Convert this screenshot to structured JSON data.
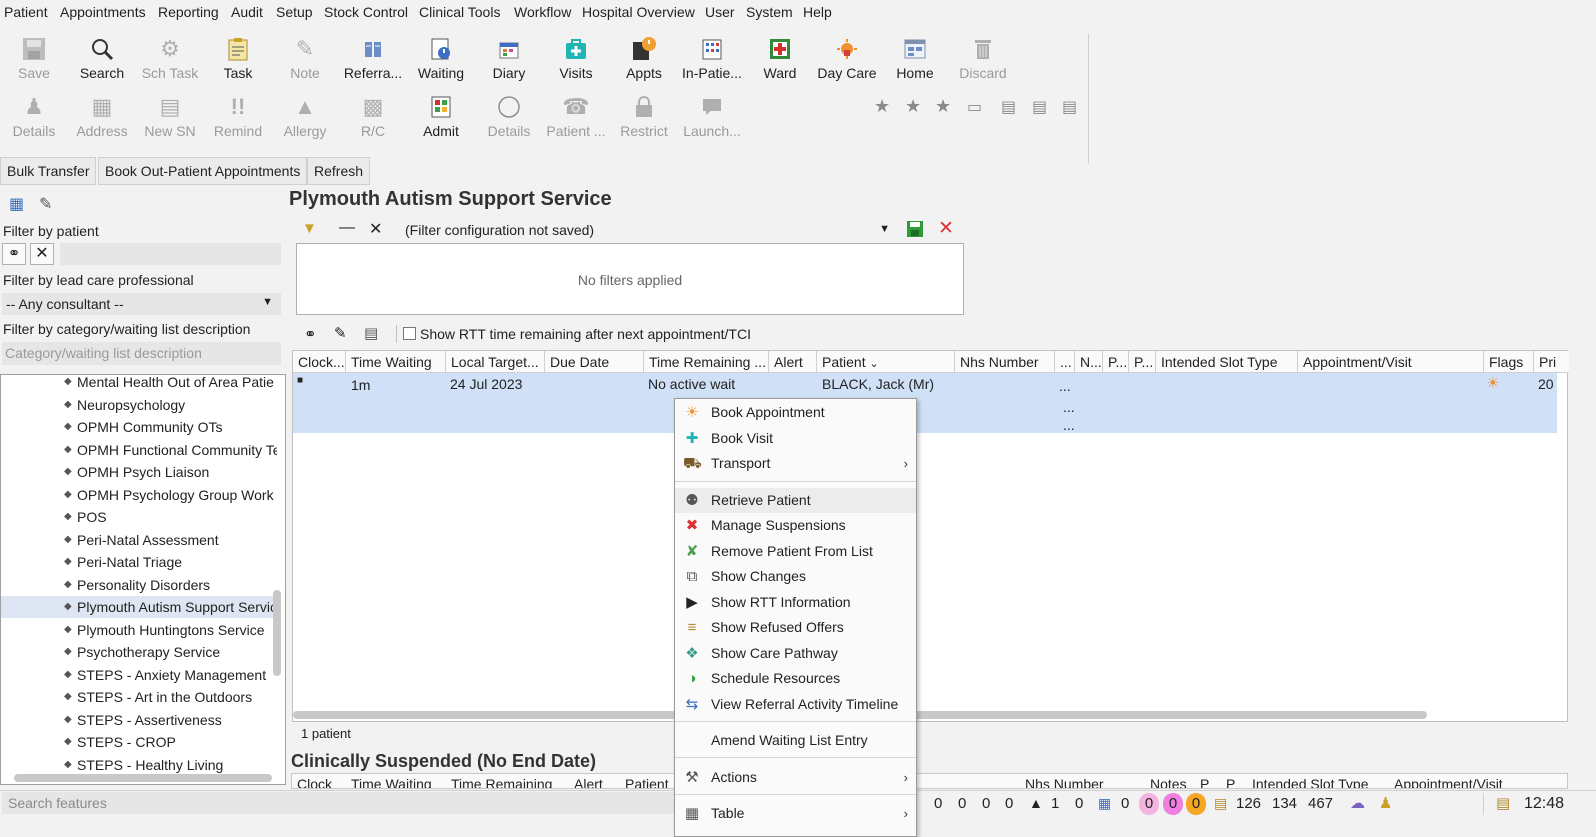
{
  "menubar": [
    {
      "label": "Patient"
    },
    {
      "label": "Appointments"
    },
    {
      "label": "Reporting"
    },
    {
      "label": "Audit"
    },
    {
      "label": "Setup"
    },
    {
      "label": "Stock Control"
    },
    {
      "label": "Clinical Tools"
    },
    {
      "label": "Workflow"
    },
    {
      "label": "Hospital Overview"
    },
    {
      "label": "User"
    },
    {
      "label": "System"
    },
    {
      "label": "Help"
    }
  ],
  "toolbar_row1": [
    {
      "label": "Save",
      "icon": "save-icon",
      "enabled": false
    },
    {
      "label": "Search",
      "icon": "search-icon",
      "enabled": true
    },
    {
      "label": "Sch Task",
      "icon": "scheduled-task-icon",
      "enabled": false
    },
    {
      "label": "Task",
      "icon": "task-icon",
      "enabled": true
    },
    {
      "label": "Note",
      "icon": "note-icon",
      "enabled": false
    },
    {
      "label": "Referra...",
      "icon": "referral-icon",
      "enabled": true
    },
    {
      "label": "Waiting",
      "icon": "waiting-list-icon",
      "enabled": true
    },
    {
      "label": "Diary",
      "icon": "diary-icon",
      "enabled": true
    },
    {
      "label": "Visits",
      "icon": "visits-icon",
      "enabled": true
    },
    {
      "label": "Appts",
      "icon": "appointments-icon",
      "enabled": true
    },
    {
      "label": "In-Patie...",
      "icon": "in-patient-icon",
      "enabled": true
    },
    {
      "label": "Ward",
      "icon": "ward-icon",
      "enabled": true
    },
    {
      "label": "Day Care",
      "icon": "day-care-icon",
      "enabled": true
    },
    {
      "label": "Home",
      "icon": "home-icon",
      "enabled": true
    },
    {
      "label": "Discard",
      "icon": "discard-icon",
      "enabled": false
    }
  ],
  "toolbar_row2": [
    {
      "label": "Details",
      "icon": "patient-details-icon",
      "enabled": false
    },
    {
      "label": "Address",
      "icon": "address-icon",
      "enabled": false
    },
    {
      "label": "New SN",
      "icon": "new-sn-icon",
      "enabled": false
    },
    {
      "label": "Remind",
      "icon": "remind-icon",
      "enabled": false
    },
    {
      "label": "Allergy",
      "icon": "allergy-icon",
      "enabled": false
    },
    {
      "label": "R/C",
      "icon": "rc-icon",
      "enabled": false
    },
    {
      "label": "Admit",
      "icon": "admit-icon",
      "enabled": true
    },
    {
      "label": "Details",
      "icon": "details-circle-icon",
      "enabled": false
    },
    {
      "label": "Patient ...",
      "icon": "patient-phone-icon",
      "enabled": false
    },
    {
      "label": "Restrict",
      "icon": "restrict-icon",
      "enabled": false
    },
    {
      "label": "Launch...",
      "icon": "launch-icon",
      "enabled": false
    }
  ],
  "action_buttons": [
    "Bulk Transfer",
    "Book Out-Patient Appointments",
    "Refresh"
  ],
  "left_panel": {
    "filter_patient_label": "Filter by patient",
    "filter_lead_label": "Filter by lead care professional",
    "consultant_value": "-- Any consultant --",
    "filter_category_label": "Filter by category/waiting list description",
    "category_placeholder": "Category/waiting list description",
    "tree_items": [
      "Mental Health Out of Area Patie",
      "Neuropsychology",
      "OPMH Community OTs",
      "OPMH Functional Community Te",
      "OPMH Psych Liaison",
      "OPMH Psychology Group Work",
      "POS",
      "Peri-Natal Assessment",
      "Peri-Natal Triage",
      "Personality Disorders",
      "Plymouth Autism Support Servic",
      "Plymouth Huntingtons Service",
      "Psychotherapy Service",
      "STEPS - Anxiety Management",
      "STEPS - Art in the Outdoors",
      "STEPS - Assertiveness",
      "STEPS - CROP",
      "STEPS - Healthy Living"
    ],
    "selected_index": 10
  },
  "main": {
    "title": "Plymouth Autism Support Service",
    "filter_config": "(Filter configuration not saved)",
    "no_filters": "No filters applied",
    "rtt_checkbox_label": "Show RTT time remaining after next appointment/TCI",
    "columns": [
      "Clock...",
      "Time Waiting",
      "Local Target...",
      "Due Date",
      "Time Remaining ...",
      "Alert",
      "Patient",
      "Nhs Number",
      "...",
      "N...",
      "P...",
      "P...",
      "Intended Slot Type",
      "Appointment/Visit",
      "Flags",
      "Pri"
    ],
    "row": {
      "time_waiting": "1m",
      "local_target": "24 Jul 2023",
      "time_remaining": "No active wait",
      "patient": "BLACK, Jack (Mr)",
      "dots": "...",
      "pri": "20"
    },
    "patient_count": "1 patient",
    "suspended_title": "Clinically Suspended (No End Date)",
    "suspended_columns": [
      "Clock",
      "Time Waiting",
      "Time Remaining",
      "Alert",
      "Patient",
      "Nhs Number",
      "Notes",
      "P",
      "P",
      "Intended Slot Type",
      "Appointment/Visit"
    ]
  },
  "context_menu": [
    {
      "label": "Book Appointment",
      "icon": "book-appointment-icon"
    },
    {
      "label": "Book Visit",
      "icon": "book-visit-icon"
    },
    {
      "label": "Transport",
      "icon": "transport-icon",
      "submenu": true
    },
    {
      "label": "Retrieve Patient",
      "icon": "retrieve-patient-icon",
      "highlight": true
    },
    {
      "label": "Manage Suspensions",
      "icon": "manage-suspensions-icon"
    },
    {
      "label": "Remove Patient From List",
      "icon": "remove-patient-icon"
    },
    {
      "label": "Show Changes",
      "icon": "show-changes-icon"
    },
    {
      "label": "Show RTT Information",
      "icon": "play-arrow-icon"
    },
    {
      "label": "Show Refused Offers",
      "icon": "refused-offers-icon"
    },
    {
      "label": "Show Care Pathway",
      "icon": "care-pathway-icon"
    },
    {
      "label": "Schedule Resources",
      "icon": "schedule-resources-icon"
    },
    {
      "label": "View Referral Activity Timeline",
      "icon": "timeline-icon"
    },
    {
      "label": "Amend Waiting List Entry",
      "icon": ""
    },
    {
      "label": "Actions",
      "icon": "actions-icon",
      "submenu": true
    },
    {
      "label": "Table",
      "icon": "table-icon",
      "submenu": true
    }
  ],
  "statusbar": {
    "search_placeholder": "Search features",
    "counts_zero": [
      "0",
      "0",
      "0",
      "0",
      "0"
    ],
    "count_a": "1",
    "count_b": "0",
    "count_c": "0",
    "badge_pink1": "0",
    "badge_pink2": "0",
    "badge_orange": "0",
    "n1": "126",
    "n2": "134",
    "n3": "467",
    "time": "12:48"
  }
}
